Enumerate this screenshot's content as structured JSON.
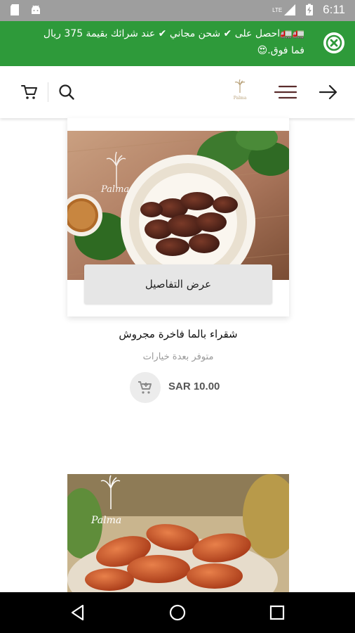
{
  "status_bar": {
    "time": "6:11",
    "network": "LTE",
    "battery_icon": "battery-charging-icon",
    "signal_icon": "signal-icon"
  },
  "promo": {
    "text": "🚛🚛احصل على ✔ شحن مجاني ✔ عند شرائك بقيمة 375 ريال فما فوق.😍",
    "close_icon": "close-circle-icon",
    "background": "#2e9a3a"
  },
  "header": {
    "back_icon": "arrow-right-icon",
    "menu_icon": "hamburger-menu-icon",
    "logo_text": "Palma",
    "search_icon": "search-icon",
    "cart_icon": "cart-icon"
  },
  "product": {
    "details_label": "عرض التفاصيل",
    "name": "شقراء بالما فاخرة مجروش",
    "availability": "متوفر بعدة خيارات",
    "price": "SAR 10.00",
    "image_logo_text": "Palma"
  },
  "product2": {
    "image_logo_text": "Palma"
  },
  "nav_bar": {
    "back_icon": "nav-back-icon",
    "home_icon": "nav-home-icon",
    "recents_icon": "nav-recents-icon"
  }
}
